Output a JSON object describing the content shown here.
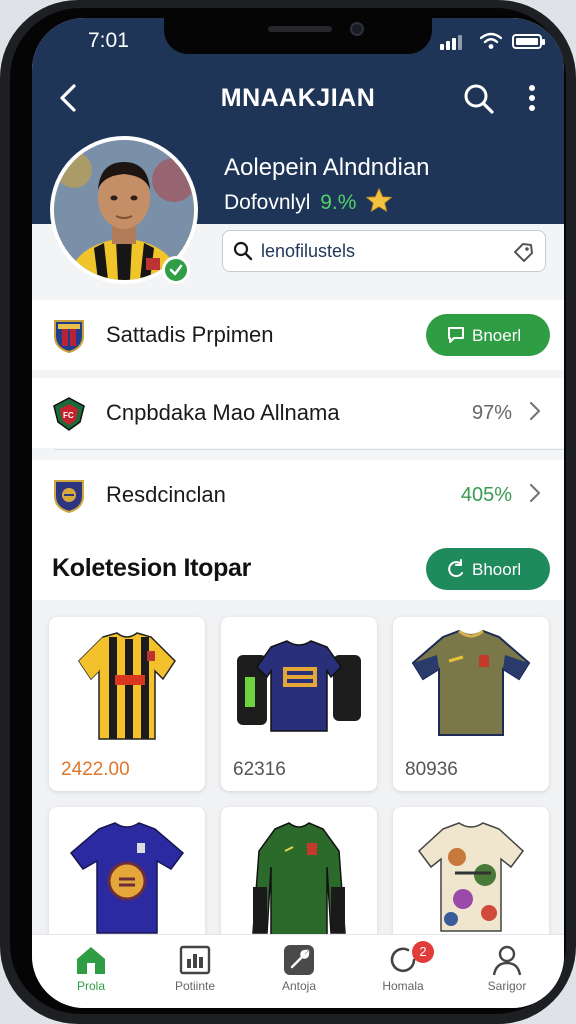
{
  "status": {
    "time": "7:01"
  },
  "header": {
    "title": "MNAAKJIAN"
  },
  "profile": {
    "name": "Aolepein Alndndian",
    "subtitle": "Dofovnlyl",
    "percent": "9.%"
  },
  "search": {
    "placeholder": "lenofilustels"
  },
  "list": {
    "items": [
      {
        "label": "Sattadis Prpimen",
        "button": "Bnoerl"
      },
      {
        "label": "Cnpbdaka Mao Allnama",
        "value": "97%"
      },
      {
        "label": "Resdcinclan",
        "value": "405%"
      }
    ]
  },
  "collection": {
    "title": "Koletesion Itopar",
    "button": "Bhoorl",
    "products": [
      {
        "price": "2422.00",
        "icon": "yellow-black-jersey"
      },
      {
        "price": "62316",
        "icon": "navy-jersey-with-bags"
      },
      {
        "price": "80936",
        "icon": "olive-jersey"
      },
      {
        "price": "",
        "icon": "purple-jersey"
      },
      {
        "price": "",
        "icon": "green-long-sleeve-jersey"
      },
      {
        "price": "",
        "icon": "camo-pattern-jersey"
      }
    ]
  },
  "tabs": [
    {
      "label": "Prola",
      "icon": "home-icon"
    },
    {
      "label": "Potiinte",
      "icon": "chart-icon"
    },
    {
      "label": "Antoja",
      "icon": "tools-icon"
    },
    {
      "label": "Homala",
      "icon": "refresh-icon",
      "badge": "2"
    },
    {
      "label": "Sarigor",
      "icon": "user-icon"
    }
  ],
  "colors": {
    "header_bg": "#1f3558",
    "accent_green": "#2e9d44",
    "price_orange": "#e0752b",
    "badge_red": "#e23b3b"
  }
}
